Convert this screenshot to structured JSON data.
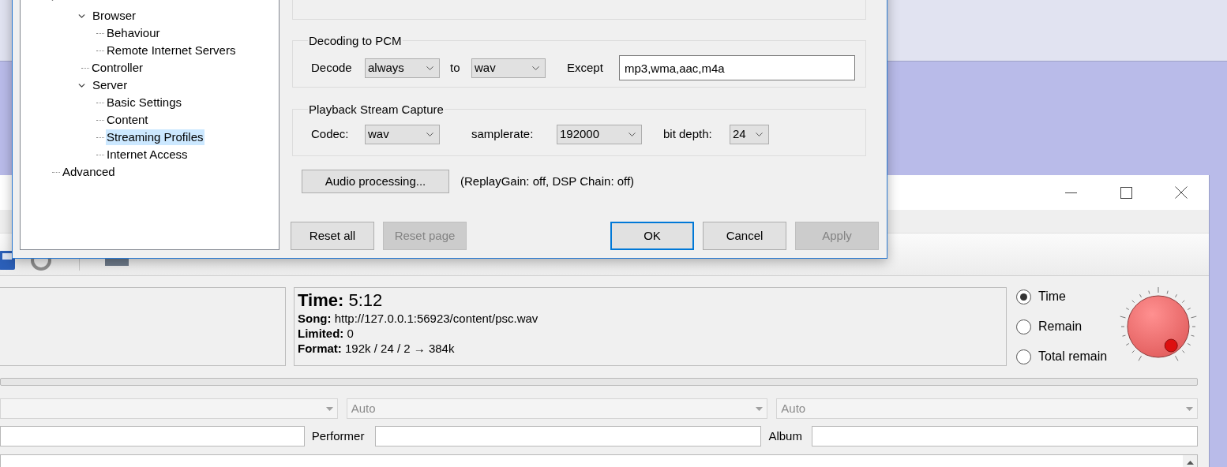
{
  "dialog": {
    "tree": [
      {
        "expanded": true,
        "children": [
          {
            "label": "Browser",
            "selected": false,
            "expanded": true,
            "children": [
              {
                "label": "Behaviour",
                "selected": false
              },
              {
                "label": "Remote Internet Servers",
                "selected": false
              }
            ]
          },
          {
            "label": "Controller",
            "selected": false
          },
          {
            "label": "Server",
            "selected": false,
            "expanded": true,
            "children": [
              {
                "label": "Basic Settings",
                "selected": false
              },
              {
                "label": "Content",
                "selected": false
              },
              {
                "label": "Streaming Profiles",
                "selected": true
              },
              {
                "label": "Internet Access",
                "selected": false
              }
            ]
          }
        ]
      },
      {
        "label": "Advanced",
        "selected": false
      }
    ],
    "decoding": {
      "title": "Decoding to PCM",
      "decode_label": "Decode",
      "decode": "always",
      "to_label": "to",
      "target": "wav",
      "except_label": "Except",
      "except_value": "mp3,wma,aac,m4a"
    },
    "capture": {
      "title": "Playback Stream Capture",
      "codec_label": "Codec:",
      "codec": "wav",
      "samplerate_label": "samplerate:",
      "samplerate": "192000",
      "bitdepth_label": "bit depth:",
      "bitdepth": "24"
    },
    "audio_processing": {
      "button": "Audio processing...",
      "status": "(ReplayGain: off, DSP Chain: off)"
    },
    "buttons": [
      {
        "label": "Reset all",
        "disabled": false,
        "default": false
      },
      {
        "label": "Reset page",
        "disabled": true,
        "default": false
      },
      {
        "label": "OK",
        "disabled": false,
        "default": true
      },
      {
        "label": "Cancel",
        "disabled": false,
        "default": false
      },
      {
        "label": "Apply",
        "disabled": true,
        "default": false
      }
    ]
  },
  "main_window": {
    "info": {
      "time": "**Time:** 5:12",
      "lines": [
        "**Song:** http://127.0.0.1:56923/content/psc.wav",
        "**Limited:** 0",
        "**Format:** 192k / 24 / 2 → 384k"
      ]
    },
    "display_modes": [
      {
        "label": "Time",
        "selected": true
      },
      {
        "label": "Remain",
        "selected": false
      },
      {
        "label": "Total remain",
        "selected": false
      }
    ],
    "combos": [
      {
        "disabled": true
      },
      {
        "value": "Auto",
        "disabled": true
      },
      {
        "value": "Auto",
        "disabled": true
      }
    ],
    "tags": {
      "performer_label": "Performer",
      "album_label": "Album"
    }
  }
}
